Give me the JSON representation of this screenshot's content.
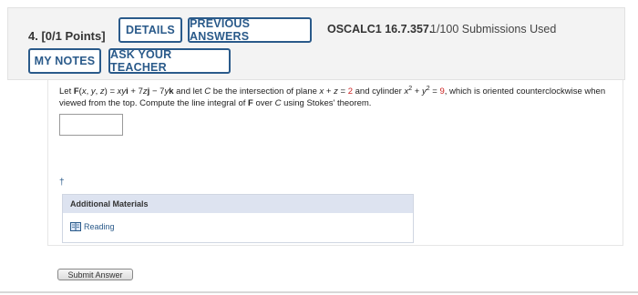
{
  "header": {
    "question_points": "4. [0/1 Points]",
    "details_label": "DETAILS",
    "previous_answers_label": "PREVIOUS ANSWERS",
    "source_code": "OSCALC1 16.7.357.",
    "submissions": "1/100 Submissions Used",
    "my_notes_label": "MY NOTES",
    "ask_teacher_label": "ASK YOUR TEACHER"
  },
  "problem": {
    "text_line1_prefix": "Let ",
    "vector_field": "F(x, y, z) = xyi + 7zj − 7yk",
    "text_mid": " and let C be the intersection of plane x + z = ",
    "plane_value": "2",
    "cylinder_text": " and cylinder x² + y² = ",
    "cylinder_value": "9",
    "text_line1_suffix": ", which is oriented",
    "text_line2": "counterclockwise when viewed from the top. Compute the line integral of F over C using Stokes' theorem.",
    "answer_value": "",
    "dagger": "†"
  },
  "additional_materials": {
    "title": "Additional Materials",
    "reading_label": "Reading"
  },
  "submit": {
    "label": "Submit Answer"
  },
  "colors": {
    "accent": "#2a5a8a",
    "highlight": "#cc2222",
    "panel": "#f3f3f3",
    "materials_header": "#dde3f0"
  }
}
